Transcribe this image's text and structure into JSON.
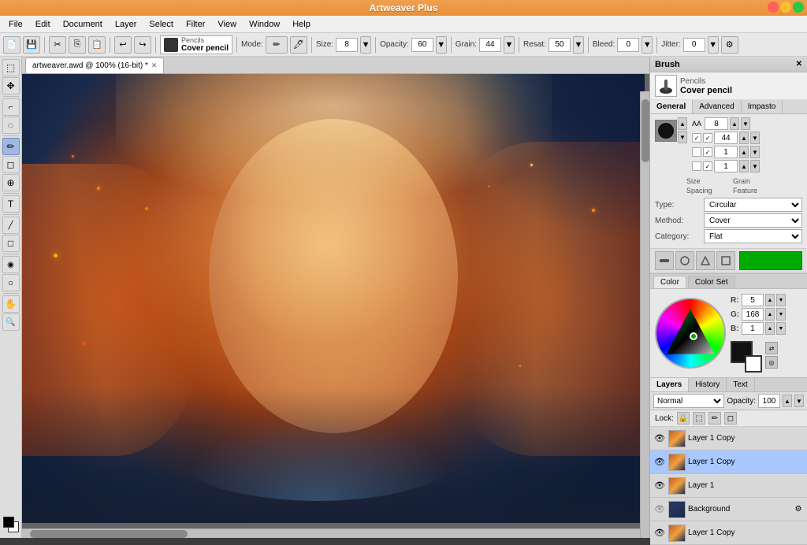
{
  "app": {
    "title": "Artweaver Plus",
    "window_controls": [
      "close",
      "min",
      "max"
    ]
  },
  "menubar": {
    "items": [
      "File",
      "Edit",
      "Document",
      "Layer",
      "Select",
      "Filter",
      "View",
      "Window",
      "Help"
    ]
  },
  "toolbar": {
    "brush_category": "Pencils",
    "brush_name": "Cover pencil",
    "mode_label": "Mode:",
    "size_label": "Size:",
    "size_value": "8",
    "opacity_label": "Opacity:",
    "opacity_value": "60",
    "grain_label": "Grain:",
    "grain_value": "44",
    "resat_label": "Resat:",
    "resat_value": "50",
    "bleed_label": "Bleed:",
    "bleed_value": "0",
    "jitter_label": "Jitter:",
    "jitter_value": "0"
  },
  "canvas": {
    "tab_label": "artweaver.awd @ 100% (16-bit) *",
    "zoom": "100%",
    "bit_depth": "16-bit"
  },
  "brush_panel": {
    "title": "Brush",
    "category": "Pencils",
    "name": "Cover pencil",
    "tabs": [
      "General",
      "Advanced",
      "Impasto"
    ],
    "active_tab": "General",
    "size_label": "Size:",
    "size_value": "8",
    "grain_label": "Grain:",
    "grain_value": "44",
    "spacing_label": "Spacing:",
    "spacing_value": "1",
    "feature_label": "Feature:",
    "feature_value": "1",
    "type_label": "Type:",
    "type_value": "Circular",
    "method_label": "Method:",
    "method_value": "Cover",
    "category_label": "Category:",
    "category_value": "Flat"
  },
  "color_panel": {
    "tabs": [
      "Color",
      "Color Set"
    ],
    "active_tab": "Color",
    "r_label": "R:",
    "r_value": "5",
    "g_label": "G:",
    "g_value": "168",
    "b_label": "B:",
    "b_value": "1"
  },
  "layers_panel": {
    "tabs": [
      "Layers",
      "History",
      "Text"
    ],
    "active_tab": "Layers",
    "mode_label": "Normal",
    "opacity_label": "Opacity:",
    "opacity_value": "100",
    "lock_label": "Lock:",
    "layers": [
      {
        "name": "Layer 1 Copy",
        "visible": true,
        "active": false,
        "type": "portrait"
      },
      {
        "name": "Layer 1 Copy",
        "visible": true,
        "active": true,
        "type": "portrait"
      },
      {
        "name": "Layer 1",
        "visible": true,
        "active": false,
        "type": "portrait"
      },
      {
        "name": "Background",
        "visible": true,
        "active": false,
        "type": "bg",
        "has_settings": true
      },
      {
        "name": "Layer 1 Copy",
        "visible": true,
        "active": false,
        "type": "portrait"
      }
    ]
  },
  "tools": [
    {
      "name": "selection-tool",
      "icon": "⬚"
    },
    {
      "name": "move-tool",
      "icon": "✥"
    },
    {
      "name": "crop-tool",
      "icon": "⌐"
    },
    {
      "name": "lasso-tool",
      "icon": "⊙"
    },
    {
      "name": "transform-tool",
      "icon": "↔"
    },
    {
      "name": "brush-tool",
      "icon": "✏"
    },
    {
      "name": "eraser-tool",
      "icon": "◻"
    },
    {
      "name": "clone-tool",
      "icon": "⊕"
    },
    {
      "name": "text-tool",
      "icon": "T"
    },
    {
      "name": "line-tool",
      "icon": "╱"
    },
    {
      "name": "blur-tool",
      "icon": "◉"
    },
    {
      "name": "dodge-tool",
      "icon": "○"
    },
    {
      "name": "pan-tool",
      "icon": "✋"
    },
    {
      "name": "zoom-tool",
      "icon": "⊕"
    }
  ]
}
